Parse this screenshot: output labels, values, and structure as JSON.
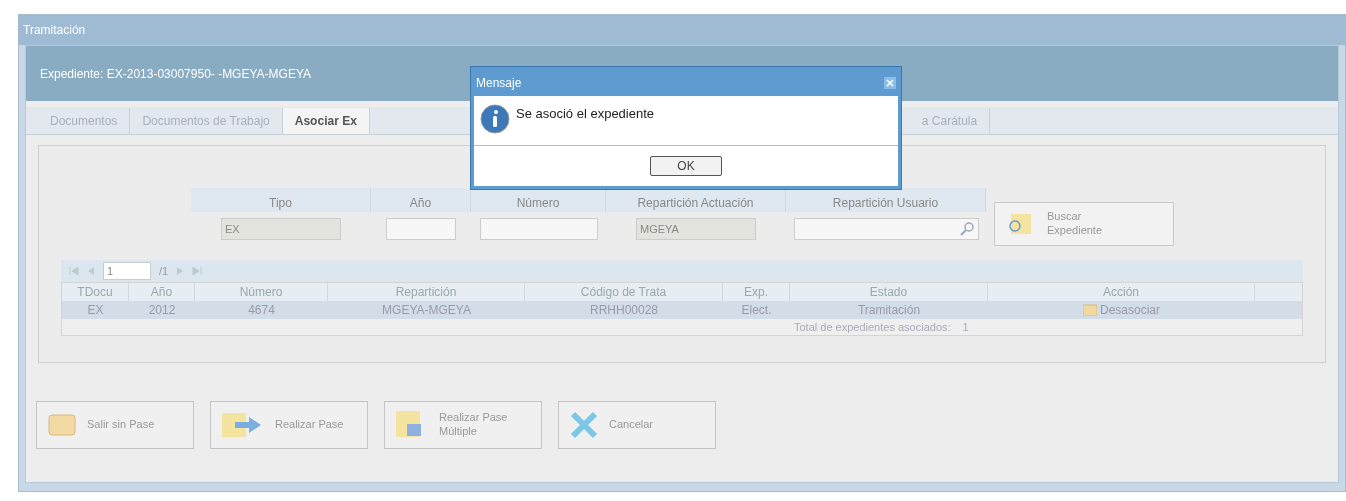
{
  "window": {
    "title": "Tramitación"
  },
  "panel": {
    "title": "Expediente: EX-2013-03007950- -MGEYA-MGEYA"
  },
  "tabs": [
    {
      "label": "Documentos",
      "selected": false
    },
    {
      "label": "Documentos de Trabajo",
      "selected": false
    },
    {
      "label": "Asociar Ex",
      "selected": true
    },
    {
      "label": "a Carátula",
      "selected": false
    }
  ],
  "search_form": {
    "columns": [
      "Tipo",
      "Año",
      "Número",
      "Repartición Actuación",
      "Repartición Usuario"
    ],
    "fields": [
      {
        "value": "EX",
        "disabled": true
      },
      {
        "disabled": false
      },
      {
        "disabled": false
      },
      {
        "value": "MGEYA",
        "disabled": true
      },
      {
        "disabled": false
      }
    ],
    "search_button": "Buscar Expediente"
  },
  "pager": {
    "page": "1",
    "total": "/1"
  },
  "table": {
    "columns": [
      "TDocu",
      "Año",
      "Número",
      "Repartición",
      "Código de Trata",
      "Exp.",
      "Estado",
      "Acción"
    ],
    "rows": [
      {
        "selected": true,
        "cells": [
          "EX",
          "2012",
          "4674",
          "MGEYA-MGEYA",
          "RRHH00028",
          "Elect.",
          "Tramitación"
        ],
        "action": "Desasociar"
      }
    ],
    "total_label": "Total de expedientes asociados:",
    "total_value": "1"
  },
  "buttons": [
    {
      "kind": "exit",
      "label": "Salir sin Pase"
    },
    {
      "kind": "pass",
      "label": "Realizar Pase"
    },
    {
      "kind": "multi",
      "label": "Realizar Pase Múltiple"
    },
    {
      "kind": "cancel",
      "label": "Cancelar"
    }
  ],
  "dialog": {
    "title": "Mensaje",
    "message": "Se asoció el expediente",
    "ok": "OK"
  }
}
